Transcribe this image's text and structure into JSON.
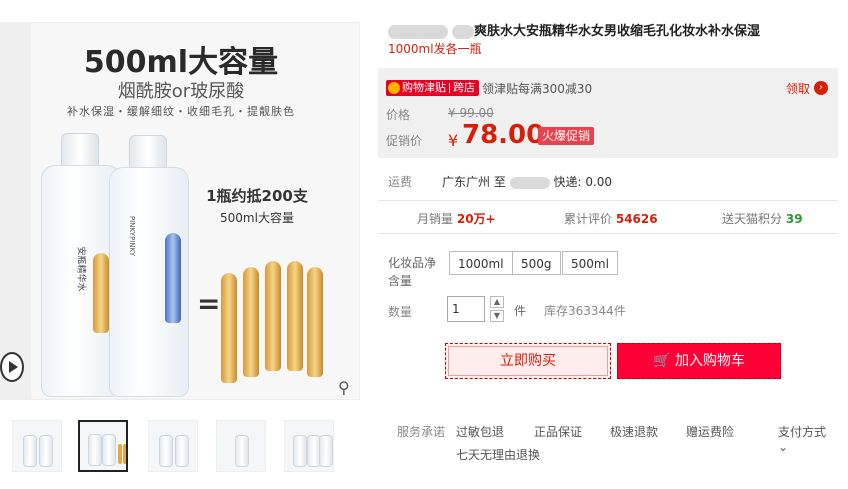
{
  "gallery": {
    "image_headline": "500ml大容量",
    "image_sub": "烟酰胺or玻尿酸",
    "image_benefits": "补水保湿・缓解细纹・收细毛孔・提靓肤色",
    "image_claim": "1瓶约抵200支",
    "image_claim_sub": "500ml大容量",
    "image_equals": "=",
    "bottle_label": "安瓶精华水",
    "bottle_brand": "PINKYPINKY"
  },
  "product": {
    "title": "爽肤水大安瓶精华水女男收缩毛孔化妆水补水保湿",
    "subtitle": "1000ml发各一瓶"
  },
  "promo": {
    "coupon_tag_a": "购物津贴",
    "coupon_tag_b": "跨店",
    "coupon_text": "领津贴每满300减30",
    "claim": "领取",
    "claim_arrow": "›",
    "price_label": "价格",
    "original_price": "¥ 99.00",
    "promo_label": "促销价",
    "currency": "¥",
    "sale_price": "78.00",
    "hot_badge": "火爆促销"
  },
  "shipping": {
    "label": "运费",
    "origin": "广东广州 至",
    "express": "快递: 0.00"
  },
  "stats": {
    "monthly_sales_label": "月销量",
    "monthly_sales": "20万+",
    "reviews_label": "累计评价",
    "reviews": "54626",
    "points_label": "送天猫积分",
    "points": "39"
  },
  "spec": {
    "label": "化妆品净含量",
    "options": [
      "1000ml",
      "500g",
      "500ml"
    ]
  },
  "quantity": {
    "label": "数量",
    "value": "1",
    "unit": "件",
    "stock": "库存363344件"
  },
  "actions": {
    "buy_now": "立即购买",
    "add_cart": "加入购物车"
  },
  "service": {
    "label": "服务承诺",
    "items": [
      "过敏包退",
      "正品保证",
      "极速退款",
      "赠运费险"
    ],
    "extra": "七天无理由退换",
    "payment": "支付方式"
  },
  "colors": {
    "accent": "#ff0036",
    "price": "#d81e06"
  }
}
